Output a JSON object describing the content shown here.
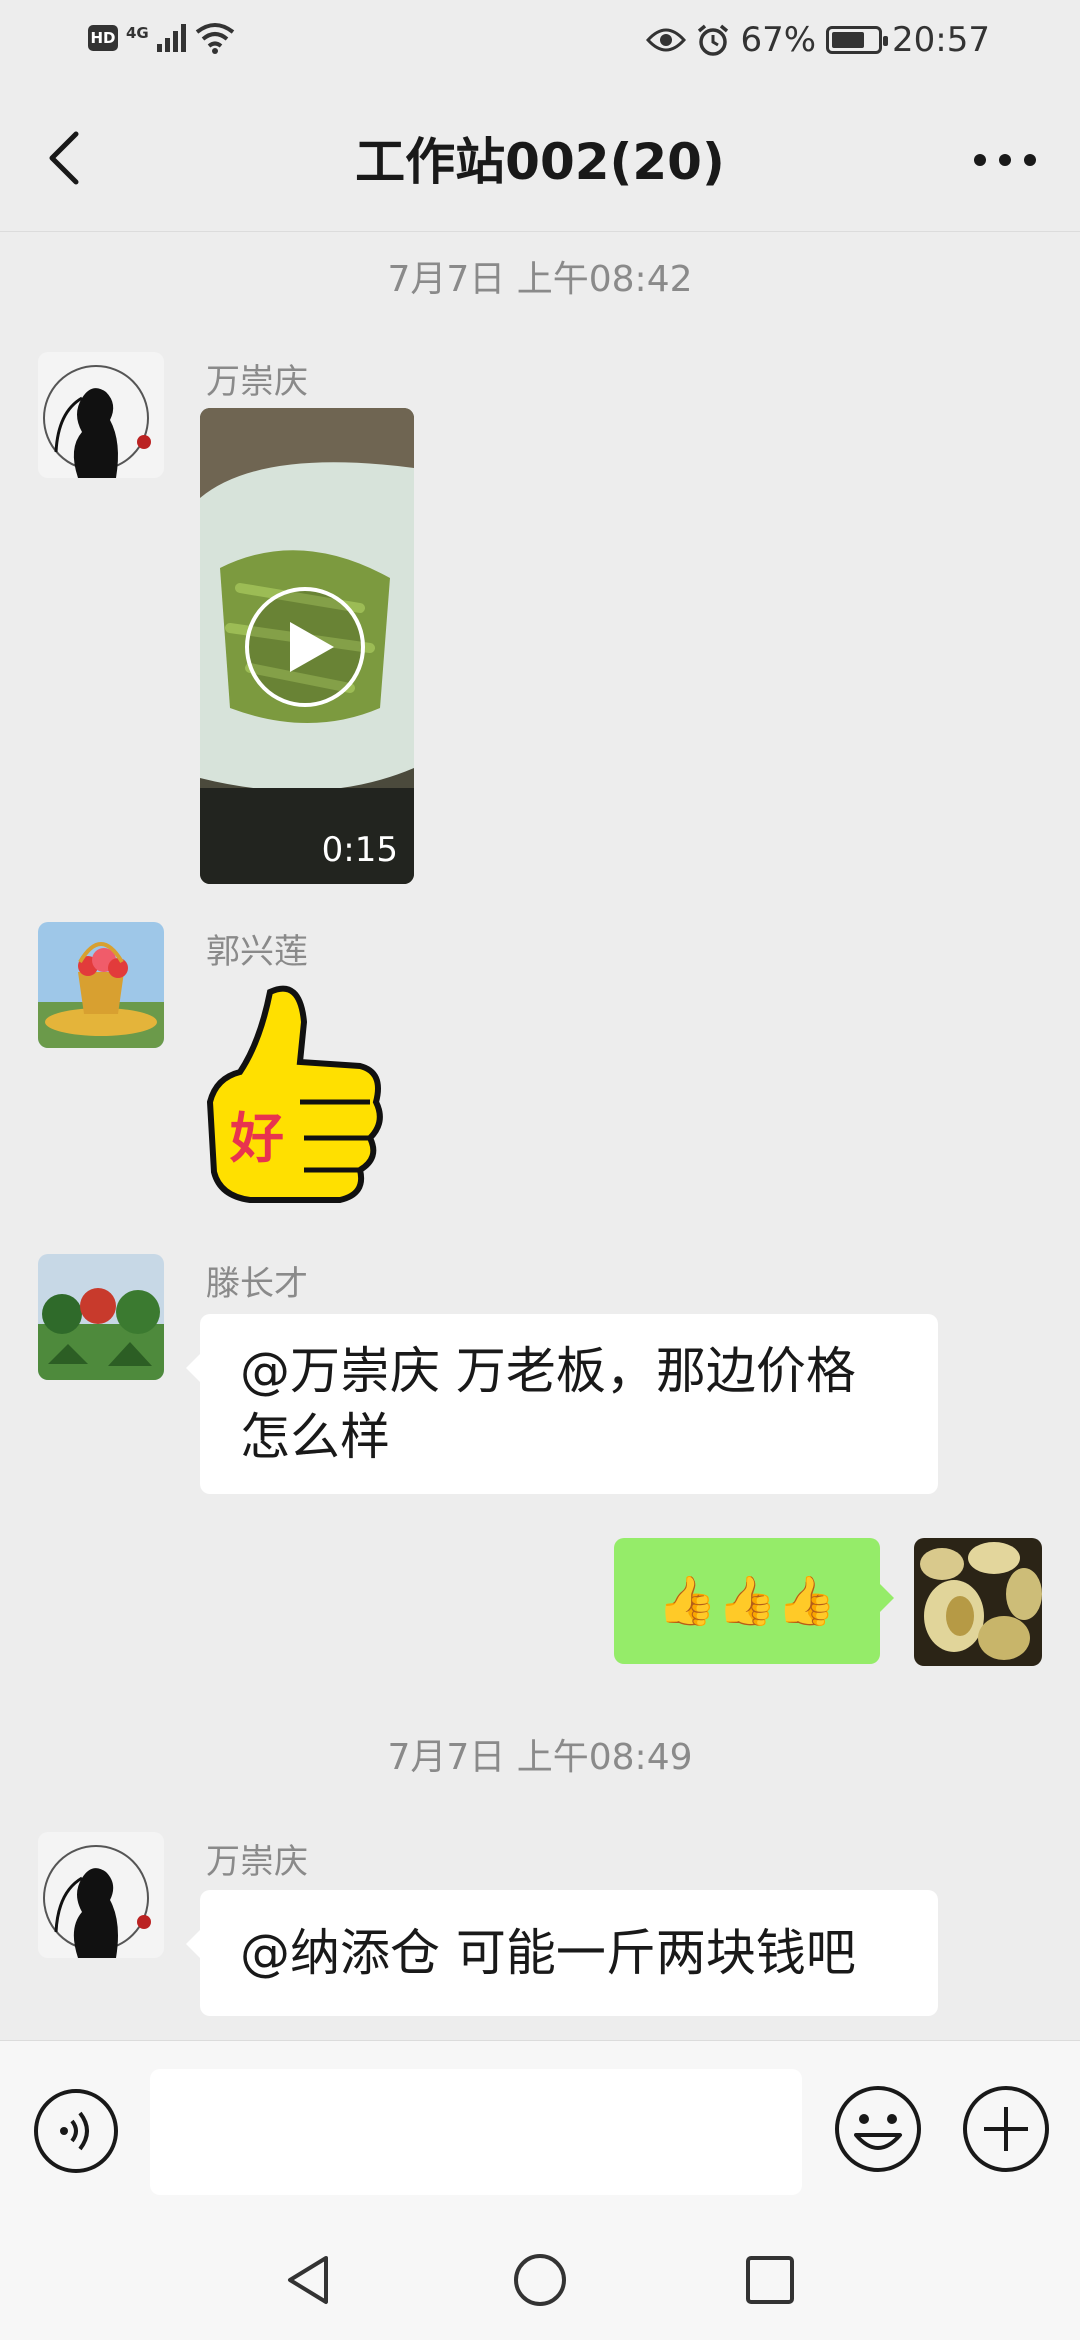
{
  "status_bar": {
    "hd": "HD",
    "network": "4G",
    "battery": "67%",
    "battery_level": 0.67,
    "time": "20:57"
  },
  "header": {
    "title": "工作站002(20)"
  },
  "messages": {
    "timestamp1": "7月7日 上午08:42",
    "msg1_sender": "万崇庆",
    "msg1_video_duration": "0:15",
    "msg2_sender": "郭兴莲",
    "msg2_sticker_text": "好",
    "msg3_sender": "滕长才",
    "msg3_text_line1": "@万崇庆  万老板，那边价格",
    "msg3_text_line2": "怎么样",
    "msg4_text": "👍👍👍",
    "timestamp2": "7月7日 上午08:49",
    "msg5_sender": "万崇庆",
    "msg5_text": "@纳添仓  可能一斤两块钱吧"
  },
  "colors": {
    "background": "#ededed",
    "self_bubble": "#95ec69",
    "other_bubble": "#ffffff",
    "secondary_text": "#8a8a8a"
  },
  "icons": {
    "back": "chevron-left-icon",
    "more": "more-icon",
    "play": "play-icon",
    "voice": "voice-icon",
    "emoji": "emoji-icon",
    "plus": "plus-icon",
    "nav_back": "triangle-back-icon",
    "nav_home": "circle-home-icon",
    "nav_recent": "square-recent-icon"
  }
}
